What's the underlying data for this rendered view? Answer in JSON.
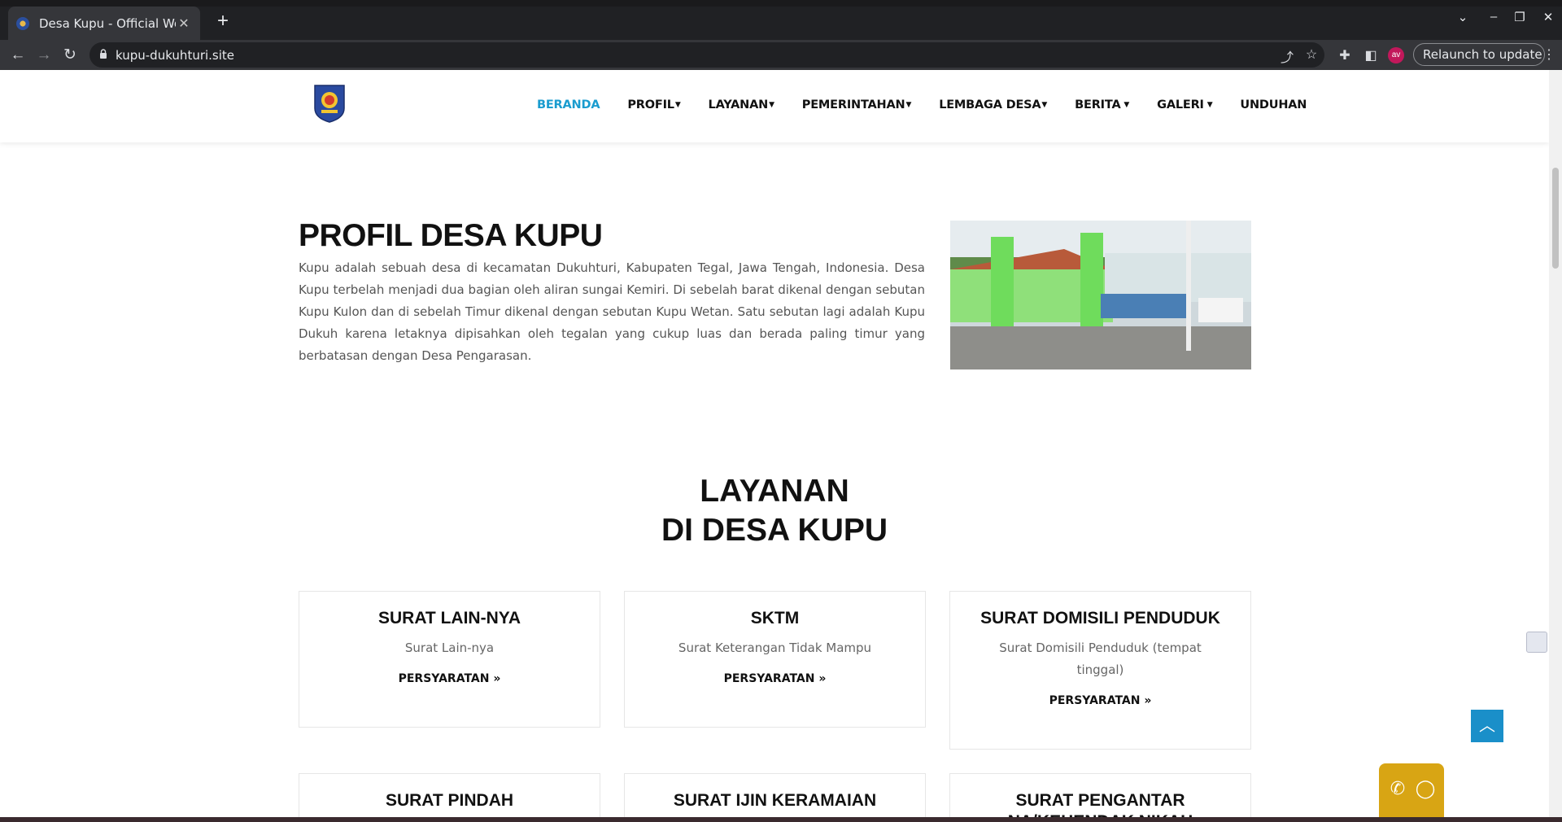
{
  "browser": {
    "tab_title": "Desa Kupu - Official Website",
    "url": "kupu-dukuhturi.site",
    "avatar_initials": "av",
    "relaunch_label": "Relaunch to update"
  },
  "nav": {
    "items": [
      {
        "label": "BERANDA",
        "active": true
      },
      {
        "label": "PROFIL",
        "caret": true
      },
      {
        "label": "LAYANAN",
        "caret": true
      },
      {
        "label": "PEMERINTAHAN",
        "caret": true
      },
      {
        "label": "LEMBAGA DESA",
        "caret": true
      },
      {
        "label": "BERITA",
        "caret": true
      },
      {
        "label": "GALERI",
        "caret": true
      },
      {
        "label": "UNDUHAN"
      }
    ]
  },
  "profile": {
    "title": "PROFIL DESA KUPU",
    "text": "Kupu adalah sebuah desa di kecamatan Dukuhturi, Kabupaten Tegal, Jawa Tengah, Indonesia. Desa Kupu terbelah menjadi dua bagian oleh aliran sungai Kemiri. Di sebelah barat dikenal dengan sebutan Kupu Kulon dan di sebelah Timur dikenal dengan sebutan Kupu Wetan. Satu sebutan lagi adalah Kupu Dukuh karena letaknya dipisahkan oleh tegalan yang cukup luas dan berada paling timur yang berbatasan dengan Desa Pengarasan."
  },
  "services": {
    "title_line1": "LAYANAN",
    "title_line2": "DI DESA KUPU",
    "req_label": "PERSYARATAN",
    "cards": [
      {
        "title": "SURAT LAIN-NYA",
        "desc": "Surat Lain-nya"
      },
      {
        "title": "SKTM",
        "desc": "Surat Keterangan Tidak Mampu"
      },
      {
        "title": "SURAT DOMISILI PENDUDUK",
        "desc": "Surat Domisili Penduduk (tempat tinggal)"
      },
      {
        "title": "SURAT PINDAH",
        "desc": ""
      },
      {
        "title": "SURAT IJIN KERAMAIAN",
        "desc": ""
      },
      {
        "title": "SURAT PENGANTAR NA/KEHENDAK NIKAH",
        "desc": ""
      }
    ]
  },
  "colors": {
    "accent": "#1a9ccf",
    "contact": "#d8a514",
    "to_top": "#1a8fc9"
  }
}
